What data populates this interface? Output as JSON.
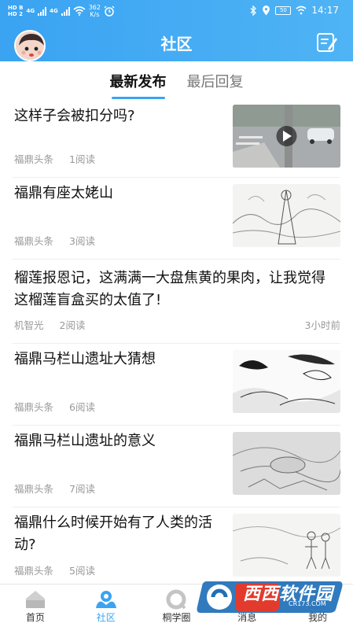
{
  "status_bar": {
    "hd1": "HD B",
    "hd2": "HD 2",
    "net1": "4G",
    "net2": "4G",
    "speed_value": "362",
    "speed_unit": "K/s",
    "battery": "50",
    "time": "14:17"
  },
  "header": {
    "title": "社区"
  },
  "tabs": [
    {
      "label": "最新发布",
      "active": true
    },
    {
      "label": "最后回复",
      "active": false
    }
  ],
  "posts": [
    {
      "title": "这样子会被扣分吗?",
      "source": "福鼎头条",
      "reads": "1阅读",
      "time": "",
      "has_video": true
    },
    {
      "title": "福鼎有座太姥山",
      "source": "福鼎头条",
      "reads": "3阅读",
      "time": ""
    },
    {
      "title": "榴莲报恩记，这满满一大盘焦黄的果肉，让我觉得这榴莲盲盒买的太值了!",
      "source": "机智光",
      "reads": "2阅读",
      "time": "3小时前"
    },
    {
      "title": "福鼎马栏山遗址大猜想",
      "source": "福鼎头条",
      "reads": "6阅读",
      "time": ""
    },
    {
      "title": "福鼎马栏山遗址的意义",
      "source": "福鼎头条",
      "reads": "7阅读",
      "time": ""
    },
    {
      "title": "福鼎什么时候开始有了人类的活动?",
      "source": "福鼎头条",
      "reads": "5阅读",
      "time": ""
    }
  ],
  "bottom_nav": [
    {
      "label": "首页",
      "icon": "home-icon",
      "active": false
    },
    {
      "label": "社区",
      "icon": "community-icon",
      "active": true
    },
    {
      "label": "桐学圈",
      "icon": "circle-icon",
      "active": false
    },
    {
      "label": "消息",
      "icon": "message-icon",
      "active": false
    },
    {
      "label": "我的",
      "icon": "profile-icon",
      "active": false
    }
  ],
  "watermark": {
    "main": "西西软件园",
    "sub": "CR173.COM"
  },
  "colors": {
    "accent": "#3aa3f2",
    "header_bg": "#4fb4f5"
  }
}
